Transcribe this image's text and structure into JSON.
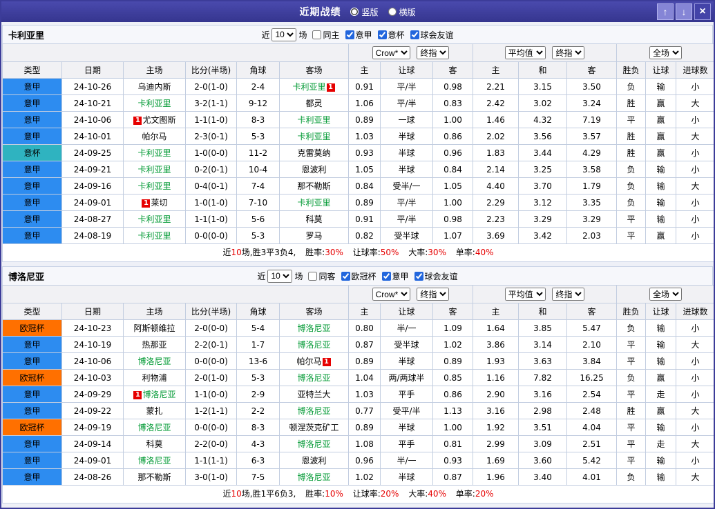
{
  "titlebar": {
    "title": "近期战绩",
    "layout_options": [
      {
        "label": "竖版",
        "checked": true
      },
      {
        "label": "横版",
        "checked": false
      }
    ],
    "up": "↑",
    "down": "↓",
    "close": "×"
  },
  "colors": {
    "titlebar": "#3c3c99",
    "league_serie_a": "#2d8cf0",
    "league_coppa_italia": "#2fb3c0",
    "league_champions": "#ff7000",
    "win_red": "#e60000",
    "lose_blue": "#1a1ad0",
    "draw_green": "#009933",
    "team_highlight": "#009933"
  },
  "sections": [
    {
      "team": "卡利亚里",
      "filter": {
        "near": "近",
        "count": "10",
        "games": "场",
        "checkboxes": [
          {
            "label": "同主",
            "checked": false
          },
          {
            "label": "意甲",
            "checked": true
          },
          {
            "label": "意杯",
            "checked": true
          },
          {
            "label": "球会友谊",
            "checked": true
          }
        ]
      },
      "selects": {
        "book": "Crow*",
        "book_close": "终指",
        "avg": "平均值",
        "avg_close": "终指",
        "scope": "全场"
      },
      "columns": [
        "类型",
        "日期",
        "主场",
        "比分(半场)",
        "角球",
        "客场",
        "主",
        "让球",
        "客",
        "主",
        "和",
        "客",
        "胜负",
        "让球",
        "进球数"
      ],
      "rows": [
        {
          "type": "意甲",
          "league": "serie-a",
          "date": "24-10-26",
          "home": {
            "name": "乌迪内斯"
          },
          "score": "2-0(1-0)",
          "score_type": "red",
          "corner": "2-4",
          "away": {
            "name": "卡利亚里",
            "green": true,
            "badge": "after"
          },
          "odds": [
            "0.91",
            "平/半",
            "0.98"
          ],
          "avg": [
            "2.21",
            "3.15",
            "3.50"
          ],
          "res": [
            [
              "负",
              "blue"
            ],
            [
              "输",
              "blue"
            ],
            [
              "小",
              "blue"
            ]
          ]
        },
        {
          "type": "意甲",
          "league": "serie-a",
          "date": "24-10-21",
          "home": {
            "name": "卡利亚里",
            "green": true
          },
          "score": "3-2(1-1)",
          "score_type": "red",
          "corner": "9-12",
          "away": {
            "name": "都灵"
          },
          "odds": [
            "1.06",
            "平/半",
            "0.83"
          ],
          "avg": [
            "2.42",
            "3.02",
            "3.24"
          ],
          "res": [
            [
              "胜",
              "red"
            ],
            [
              "赢",
              "red"
            ],
            [
              "大",
              "red"
            ]
          ]
        },
        {
          "type": "意甲",
          "league": "serie-a",
          "date": "24-10-06",
          "home": {
            "name": "尤文图斯",
            "badge": "before"
          },
          "score": "1-1(1-0)",
          "score_type": "blue",
          "corner": "8-3",
          "away": {
            "name": "卡利亚里",
            "green": true
          },
          "odds": [
            "0.89",
            "一球",
            "1.00"
          ],
          "avg": [
            "1.46",
            "4.32",
            "7.19"
          ],
          "res": [
            [
              "平",
              "green"
            ],
            [
              "赢",
              "red"
            ],
            [
              "小",
              "blue"
            ]
          ]
        },
        {
          "type": "意甲",
          "league": "serie-a",
          "date": "24-10-01",
          "home": {
            "name": "帕尔马"
          },
          "score": "2-3(0-1)",
          "score_type": "red",
          "corner": "5-3",
          "away": {
            "name": "卡利亚里",
            "green": true
          },
          "odds": [
            "1.03",
            "半球",
            "0.86"
          ],
          "avg": [
            "2.02",
            "3.56",
            "3.57"
          ],
          "res": [
            [
              "胜",
              "red"
            ],
            [
              "赢",
              "red"
            ],
            [
              "大",
              "red"
            ]
          ]
        },
        {
          "type": "意杯",
          "league": "coppa",
          "date": "24-09-25",
          "home": {
            "name": "卡利亚里",
            "green": true
          },
          "score": "1-0(0-0)",
          "score_type": "red",
          "corner": "11-2",
          "away": {
            "name": "克雷莫纳"
          },
          "odds": [
            "0.93",
            "半球",
            "0.96"
          ],
          "avg": [
            "1.83",
            "3.44",
            "4.29"
          ],
          "res": [
            [
              "胜",
              "red"
            ],
            [
              "赢",
              "red"
            ],
            [
              "小",
              "blue"
            ]
          ]
        },
        {
          "type": "意甲",
          "league": "serie-a",
          "date": "24-09-21",
          "home": {
            "name": "卡利亚里",
            "green": true
          },
          "score": "0-2(0-1)",
          "score_type": "red",
          "corner": "10-4",
          "away": {
            "name": "恩波利"
          },
          "odds": [
            "1.05",
            "半球",
            "0.84"
          ],
          "avg": [
            "2.14",
            "3.25",
            "3.58"
          ],
          "res": [
            [
              "负",
              "blue"
            ],
            [
              "输",
              "blue"
            ],
            [
              "小",
              "blue"
            ]
          ]
        },
        {
          "type": "意甲",
          "league": "serie-a",
          "date": "24-09-16",
          "home": {
            "name": "卡利亚里",
            "green": true
          },
          "score": "0-4(0-1)",
          "score_type": "red",
          "corner": "7-4",
          "away": {
            "name": "那不勒斯"
          },
          "odds": [
            "0.84",
            "受半/一",
            "1.05"
          ],
          "avg": [
            "4.40",
            "3.70",
            "1.79"
          ],
          "res": [
            [
              "负",
              "blue"
            ],
            [
              "输",
              "blue"
            ],
            [
              "大",
              "red"
            ]
          ]
        },
        {
          "type": "意甲",
          "league": "serie-a",
          "date": "24-09-01",
          "home": {
            "name": "莱切",
            "badge": "before"
          },
          "score": "1-0(1-0)",
          "score_type": "red",
          "corner": "7-10",
          "away": {
            "name": "卡利亚里",
            "green": true
          },
          "odds": [
            "0.89",
            "平/半",
            "1.00"
          ],
          "avg": [
            "2.29",
            "3.12",
            "3.35"
          ],
          "res": [
            [
              "负",
              "blue"
            ],
            [
              "输",
              "blue"
            ],
            [
              "小",
              "blue"
            ]
          ]
        },
        {
          "type": "意甲",
          "league": "serie-a",
          "date": "24-08-27",
          "home": {
            "name": "卡利亚里",
            "green": true
          },
          "score": "1-1(1-0)",
          "score_type": "blue",
          "corner": "5-6",
          "away": {
            "name": "科莫"
          },
          "odds": [
            "0.91",
            "平/半",
            "0.98"
          ],
          "avg": [
            "2.23",
            "3.29",
            "3.29"
          ],
          "res": [
            [
              "平",
              "green"
            ],
            [
              "输",
              "blue"
            ],
            [
              "小",
              "blue"
            ]
          ]
        },
        {
          "type": "意甲",
          "league": "serie-a",
          "date": "24-08-19",
          "home": {
            "name": "卡利亚里",
            "green": true
          },
          "score": "0-0(0-0)",
          "score_type": "blue",
          "corner": "5-3",
          "away": {
            "name": "罗马"
          },
          "odds": [
            "0.82",
            "受半球",
            "1.07"
          ],
          "avg": [
            "3.69",
            "3.42",
            "2.03"
          ],
          "res": [
            [
              "平",
              "green"
            ],
            [
              "赢",
              "red"
            ],
            [
              "小",
              "blue"
            ]
          ]
        }
      ],
      "summary": {
        "pre": "近",
        "num": "10",
        "post": "场,胜3平3负4,",
        "items": [
          {
            "label": "胜率:",
            "value": "30%"
          },
          {
            "label": "让球率:",
            "value": "50%"
          },
          {
            "label": "大率:",
            "value": "30%"
          },
          {
            "label": "单率:",
            "value": "40%"
          }
        ]
      }
    },
    {
      "team": "博洛尼亚",
      "filter": {
        "near": "近",
        "count": "10",
        "games": "场",
        "checkboxes": [
          {
            "label": "同客",
            "checked": false
          },
          {
            "label": "欧冠杯",
            "checked": true
          },
          {
            "label": "意甲",
            "checked": true
          },
          {
            "label": "球会友谊",
            "checked": true
          }
        ]
      },
      "selects": {
        "book": "Crow*",
        "book_close": "终指",
        "avg": "平均值",
        "avg_close": "终指",
        "scope": "全场"
      },
      "columns": [
        "类型",
        "日期",
        "主场",
        "比分(半场)",
        "角球",
        "客场",
        "主",
        "让球",
        "客",
        "主",
        "和",
        "客",
        "胜负",
        "让球",
        "进球数"
      ],
      "rows": [
        {
          "type": "欧冠杯",
          "league": "ucl",
          "date": "24-10-23",
          "home": {
            "name": "阿斯顿维拉"
          },
          "score": "2-0(0-0)",
          "score_type": "red",
          "corner": "5-4",
          "away": {
            "name": "博洛尼亚",
            "green": true
          },
          "odds": [
            "0.80",
            "半/一",
            "1.09"
          ],
          "avg": [
            "1.64",
            "3.85",
            "5.47"
          ],
          "res": [
            [
              "负",
              "blue"
            ],
            [
              "输",
              "blue"
            ],
            [
              "小",
              "blue"
            ]
          ]
        },
        {
          "type": "意甲",
          "league": "serie-a",
          "date": "24-10-19",
          "home": {
            "name": "热那亚"
          },
          "score": "2-2(0-1)",
          "score_type": "blue",
          "corner": "1-7",
          "away": {
            "name": "博洛尼亚",
            "green": true
          },
          "odds": [
            "0.87",
            "受半球",
            "1.02"
          ],
          "avg": [
            "3.86",
            "3.14",
            "2.10"
          ],
          "res": [
            [
              "平",
              "green"
            ],
            [
              "输",
              "blue"
            ],
            [
              "大",
              "red"
            ]
          ]
        },
        {
          "type": "意甲",
          "league": "serie-a",
          "date": "24-10-06",
          "home": {
            "name": "博洛尼亚",
            "green": true
          },
          "score": "0-0(0-0)",
          "score_type": "blue",
          "corner": "13-6",
          "away": {
            "name": "帕尔马",
            "badge": "after"
          },
          "odds": [
            "0.89",
            "半球",
            "0.89"
          ],
          "avg": [
            "1.93",
            "3.63",
            "3.84"
          ],
          "res": [
            [
              "平",
              "green"
            ],
            [
              "输",
              "blue"
            ],
            [
              "小",
              "blue"
            ]
          ]
        },
        {
          "type": "欧冠杯",
          "league": "ucl",
          "date": "24-10-03",
          "home": {
            "name": "利物浦"
          },
          "score": "2-0(1-0)",
          "score_type": "red",
          "corner": "5-3",
          "away": {
            "name": "博洛尼亚",
            "green": true
          },
          "odds": [
            "1.04",
            "两/两球半",
            "0.85"
          ],
          "avg": [
            "1.16",
            "7.82",
            "16.25"
          ],
          "res": [
            [
              "负",
              "blue"
            ],
            [
              "赢",
              "red"
            ],
            [
              "小",
              "blue"
            ]
          ]
        },
        {
          "type": "意甲",
          "league": "serie-a",
          "date": "24-09-29",
          "home": {
            "name": "博洛尼亚",
            "green": true,
            "badge": "before"
          },
          "score": "1-1(0-0)",
          "score_type": "blue",
          "corner": "2-9",
          "away": {
            "name": "亚特兰大"
          },
          "odds": [
            "1.03",
            "平手",
            "0.86"
          ],
          "avg": [
            "2.90",
            "3.16",
            "2.54"
          ],
          "res": [
            [
              "平",
              "green"
            ],
            [
              "走",
              "green"
            ],
            [
              "小",
              "blue"
            ]
          ]
        },
        {
          "type": "意甲",
          "league": "serie-a",
          "date": "24-09-22",
          "home": {
            "name": "蒙扎"
          },
          "score": "1-2(1-1)",
          "score_type": "red",
          "corner": "2-2",
          "away": {
            "name": "博洛尼亚",
            "green": true
          },
          "odds": [
            "0.77",
            "受平/半",
            "1.13"
          ],
          "avg": [
            "3.16",
            "2.98",
            "2.48"
          ],
          "res": [
            [
              "胜",
              "red"
            ],
            [
              "赢",
              "red"
            ],
            [
              "大",
              "red"
            ]
          ]
        },
        {
          "type": "欧冠杯",
          "league": "ucl",
          "date": "24-09-19",
          "home": {
            "name": "博洛尼亚",
            "green": true
          },
          "score": "0-0(0-0)",
          "score_type": "blue",
          "corner": "8-3",
          "away": {
            "name": "顿涅茨克矿工"
          },
          "odds": [
            "0.89",
            "半球",
            "1.00"
          ],
          "avg": [
            "1.92",
            "3.51",
            "4.04"
          ],
          "res": [
            [
              "平",
              "green"
            ],
            [
              "输",
              "blue"
            ],
            [
              "小",
              "blue"
            ]
          ]
        },
        {
          "type": "意甲",
          "league": "serie-a",
          "date": "24-09-14",
          "home": {
            "name": "科莫"
          },
          "score": "2-2(0-0)",
          "score_type": "blue",
          "corner": "4-3",
          "away": {
            "name": "博洛尼亚",
            "green": true
          },
          "odds": [
            "1.08",
            "平手",
            "0.81"
          ],
          "avg": [
            "2.99",
            "3.09",
            "2.51"
          ],
          "res": [
            [
              "平",
              "green"
            ],
            [
              "走",
              "green"
            ],
            [
              "大",
              "red"
            ]
          ]
        },
        {
          "type": "意甲",
          "league": "serie-a",
          "date": "24-09-01",
          "home": {
            "name": "博洛尼亚",
            "green": true
          },
          "score": "1-1(1-1)",
          "score_type": "blue",
          "corner": "6-3",
          "away": {
            "name": "恩波利"
          },
          "odds": [
            "0.96",
            "半/一",
            "0.93"
          ],
          "avg": [
            "1.69",
            "3.60",
            "5.42"
          ],
          "res": [
            [
              "平",
              "green"
            ],
            [
              "输",
              "blue"
            ],
            [
              "小",
              "blue"
            ]
          ]
        },
        {
          "type": "意甲",
          "league": "serie-a",
          "date": "24-08-26",
          "home": {
            "name": "那不勒斯"
          },
          "score": "3-0(1-0)",
          "score_type": "red",
          "corner": "7-5",
          "away": {
            "name": "博洛尼亚",
            "green": true
          },
          "odds": [
            "1.02",
            "半球",
            "0.87"
          ],
          "avg": [
            "1.96",
            "3.40",
            "4.01"
          ],
          "res": [
            [
              "负",
              "blue"
            ],
            [
              "输",
              "blue"
            ],
            [
              "大",
              "red"
            ]
          ]
        }
      ],
      "summary": {
        "pre": "近",
        "num": "10",
        "post": "场,胜1平6负3,",
        "items": [
          {
            "label": "胜率:",
            "value": "10%"
          },
          {
            "label": "让球率:",
            "value": "20%"
          },
          {
            "label": "大率:",
            "value": "40%"
          },
          {
            "label": "单率:",
            "value": "20%"
          }
        ]
      }
    }
  ]
}
